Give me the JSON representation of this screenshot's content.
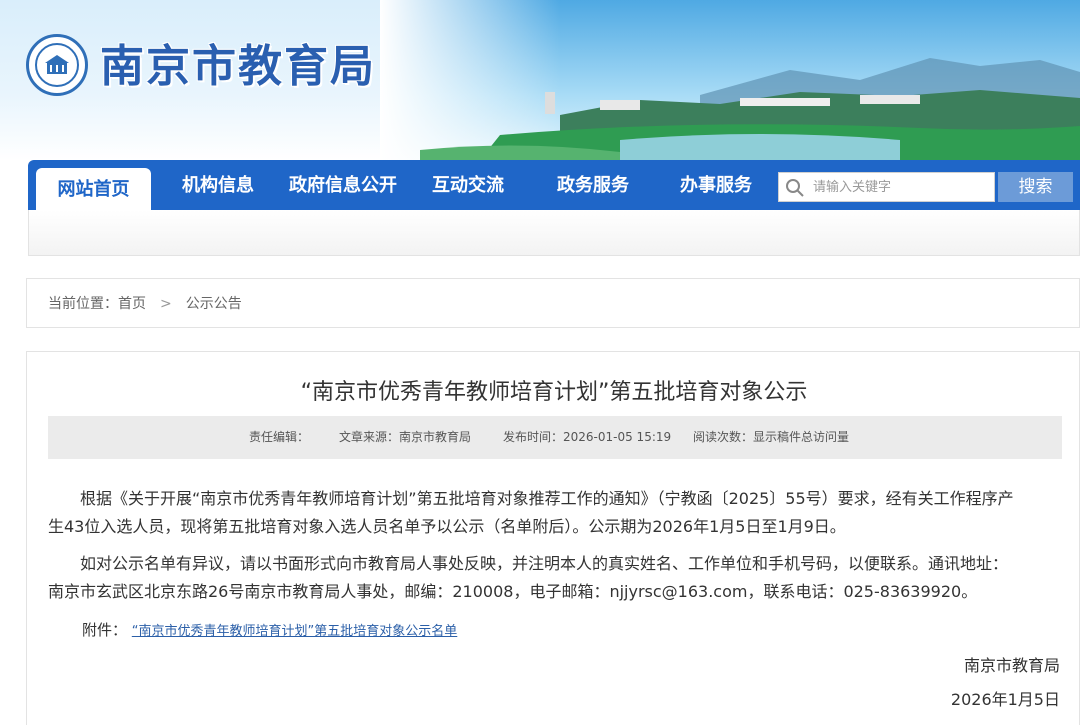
{
  "header": {
    "site_title": "南京市教育局"
  },
  "nav": {
    "items": [
      {
        "label": "网站首页",
        "active": true
      },
      {
        "label": "机构信息",
        "active": false
      },
      {
        "label": "政府信息公开",
        "active": false
      },
      {
        "label": "互动交流",
        "active": false
      },
      {
        "label": "政务服务",
        "active": false
      },
      {
        "label": "办事服务",
        "active": false
      }
    ],
    "search_placeholder": "请输入关键字",
    "search_button": "搜索"
  },
  "breadcrumb": {
    "prefix": "当前位置：",
    "home": "首页",
    "separator": ">",
    "current": "公示公告"
  },
  "article": {
    "title": "“南京市优秀青年教师培育计划”第五批培育对象公示",
    "meta": {
      "editor": "责任编辑：",
      "source": "文章来源：南京市教育局",
      "publish_time": "发布时间：2026-01-05 15:19",
      "read_count": "阅读次数：显示稿件总访问量"
    },
    "paragraph1_line1": "根据《关于开展“南京市优秀青年教师培育计划”第五批培育对象推荐工作的通知》（宁教函〔2025〕55号）要求，经有关工作程序产",
    "paragraph1_line2": "生43位入选人员，现将第五批培育对象入选人员名单予以公示（名单附后）。公示期为2026年1月5日至1月9日。",
    "paragraph2_line1": "如对公示名单有异议，请以书面形式向市教育局人事处反映，并注明本人的真实姓名、工作单位和手机号码，以便联系。通讯地址：",
    "paragraph2_line2": "南京市玄武区北京东路26号南京市教育局人事处，邮编：210008，电子邮箱：njjyrsc@163.com，联系电话：025-83639920。",
    "attachment_label": "附件：",
    "attachment_link": "“南京市优秀青年教师培育计划”第五批培育对象公示名单",
    "signature": "南京市教育局",
    "date": "2026年1月5日"
  },
  "colors": {
    "nav_blue": "#1f66c8",
    "title_blue": "#2a5fb0",
    "link_blue": "#2b5fa8"
  }
}
